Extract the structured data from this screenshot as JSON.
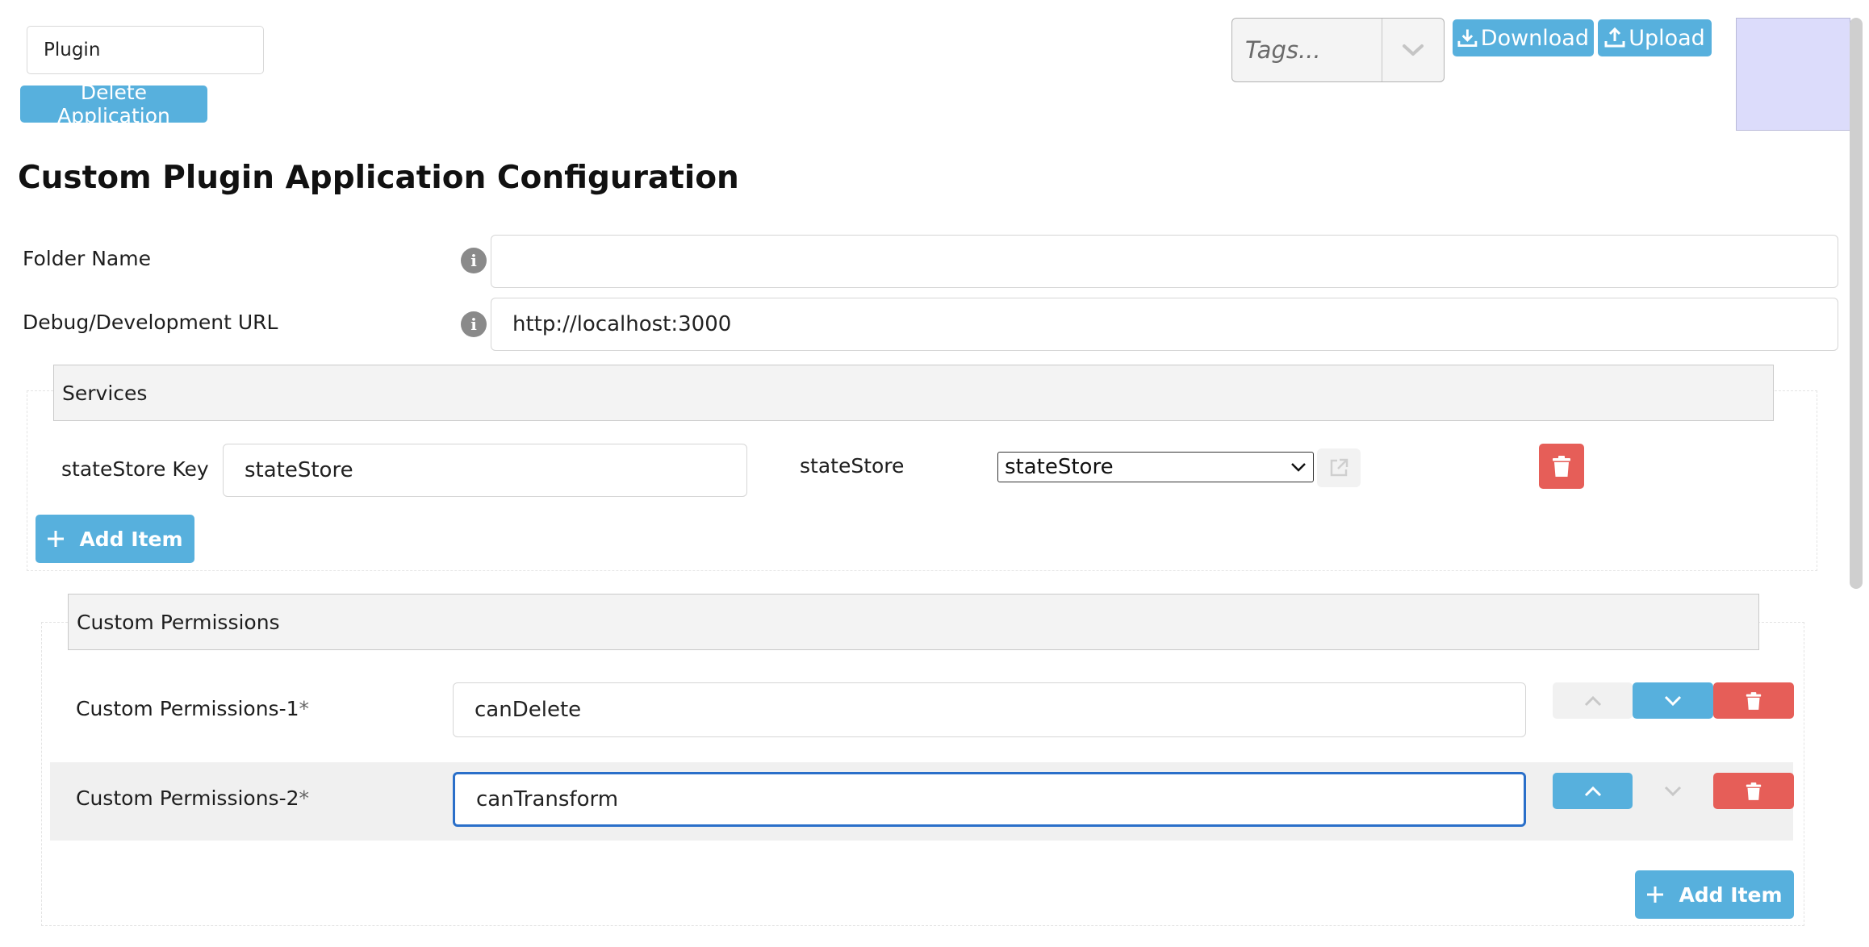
{
  "header": {
    "name_value": "Plugin",
    "delete_label": "Delete Application",
    "tags_placeholder": "Tags...",
    "download_label": "Download",
    "upload_label": "Upload"
  },
  "page_title": "Custom Plugin Application Configuration",
  "fields": {
    "folder_name": {
      "label": "Folder Name",
      "value": ""
    },
    "debug_url": {
      "label": "Debug/Development URL",
      "value": "http://localhost:3000"
    }
  },
  "services": {
    "title": "Services",
    "key_label": "stateStore Key",
    "key_value": "stateStore",
    "store_label": "stateStore",
    "store_selected": "stateStore",
    "add_label": "Add Item"
  },
  "custom_permissions": {
    "title": "Custom Permissions",
    "items": [
      {
        "label": "Custom Permissions-1",
        "value": "canDelete"
      },
      {
        "label": "Custom Permissions-2",
        "value": "canTransform"
      }
    ],
    "required_mark": "*",
    "add_label": "Add Item"
  },
  "colors": {
    "primary": "#57b0dd",
    "danger": "#e65e58",
    "focus": "#2a6fc9"
  },
  "icons": [
    "chevron-down-icon",
    "download-icon",
    "upload-icon",
    "info-icon",
    "external-link-icon",
    "trash-icon",
    "plus-icon",
    "chevron-up-icon"
  ]
}
